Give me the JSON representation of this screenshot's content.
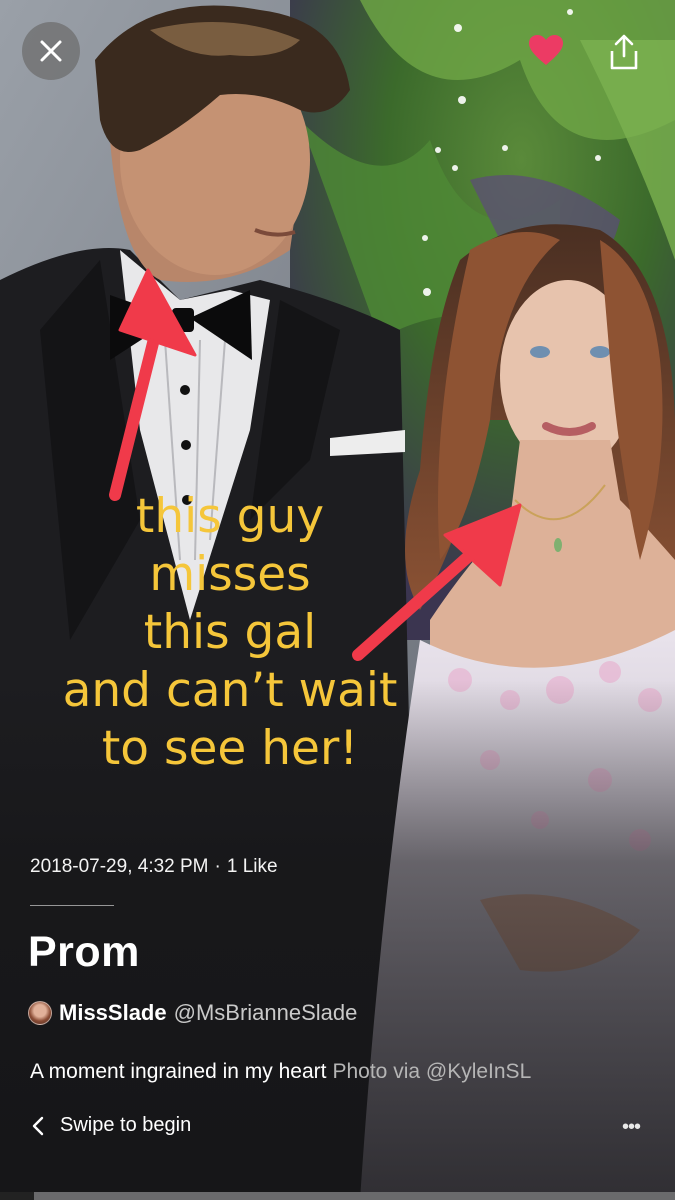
{
  "caption": {
    "lines": [
      "this guy",
      "misses",
      "this gal",
      "and can’t wait",
      "to see her!"
    ],
    "color": "#f5c63a"
  },
  "post": {
    "timestamp": "2018-07-29, 4:32 PM",
    "separator": "·",
    "likes": "1 Like",
    "title": "Prom",
    "author_name": "MissSlade",
    "author_handle": "@MsBrianneSlade",
    "description": "A moment ingrained in my heart",
    "photo_credit": "Photo via @KyleInSL"
  },
  "footer": {
    "swipe_label": "Swipe to begin",
    "more_label": "•••"
  },
  "icons": {
    "close": "close-icon",
    "like": "heart-icon",
    "share": "share-icon",
    "back": "chevron-left-icon",
    "more": "more-icon"
  },
  "colors": {
    "heart": "#ec3b64",
    "arrow": "#f03a4a",
    "caption": "#f5c63a"
  }
}
